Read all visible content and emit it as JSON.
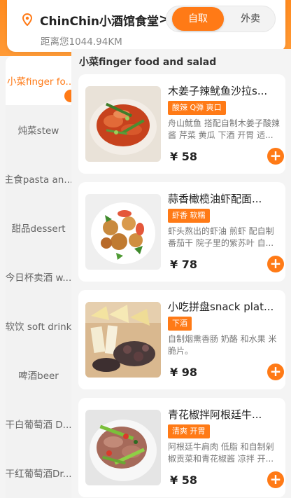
{
  "header": {
    "store_name": "ChinChin小酒馆食堂",
    "distance": "距离您1044.94KM",
    "toggle": {
      "active": "自取",
      "inactive": "外卖"
    }
  },
  "sidebar": {
    "items": [
      "小菜finger fo...",
      "炖菜stew",
      "主食pasta an...",
      "甜品dessert",
      "今日杯卖酒 w...",
      "软饮 soft drink",
      "啤酒beer",
      "干白葡萄酒 D...",
      "干红葡萄酒Dr..."
    ]
  },
  "section_title": "小菜finger food and salad",
  "products": [
    {
      "title": "木姜子辣鱿鱼沙拉s...",
      "tag": "酸辣 Q弹 爽口",
      "desc": "舟山鱿鱼 搭配自制木姜子酸辣酱 芹菜 黄瓜 下酒 开胃 适...",
      "price": "¥ 58"
    },
    {
      "title": "蒜香橄榄油虾配面...",
      "tag": "虾香 软糯",
      "desc": "虾头熬出的虾油 煎虾 配自制番茄干 院子里的紫苏叶 自...",
      "price": "¥ 78"
    },
    {
      "title": "小吃拼盘snack plat...",
      "tag": "下酒",
      "desc": "自制烟熏香肠 奶酪 和水果 米脆片。",
      "price": "¥ 98"
    },
    {
      "title": "青花椒拌阿根廷牛...",
      "tag": "清爽 开胃",
      "desc": "阿根廷牛肩肉 低脂 和自制剁椒贡菜和青花椒酱 凉拌 开...",
      "price": "¥ 58"
    }
  ],
  "colors": {
    "accent": "#ff7a16"
  }
}
